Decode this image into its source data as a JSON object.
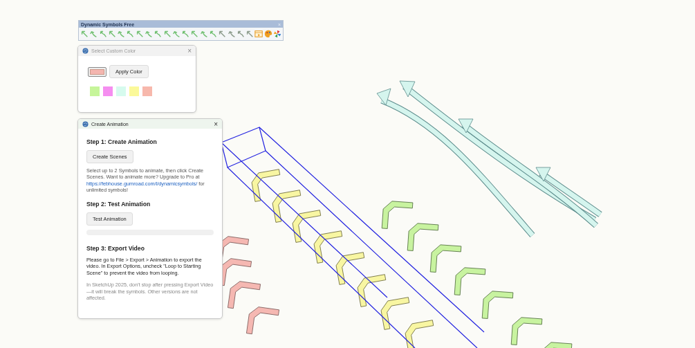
{
  "toolbar": {
    "title": "Dynamic Symbols Free",
    "close": "×"
  },
  "color_dialog": {
    "title": "Select Custom Color",
    "close": "×",
    "current_color": {
      "color": "#f4b6b0"
    },
    "apply_button": "Apply Color",
    "swatches": [
      {
        "color": "#c6f59a"
      },
      {
        "color": "#f58ef0"
      },
      {
        "color": "#d6fbee"
      },
      {
        "color": "#fbf99a"
      },
      {
        "color": "#f7b8ac"
      }
    ]
  },
  "animation_dialog": {
    "title": "Create Animation",
    "close": "×",
    "step1": {
      "heading": "Step 1: Create Animation",
      "button": "Create Scenes",
      "text_before": "Select up to 2 Symbols to animate, then click Create Scenes. Want to animate more? Upgrade to Pro at ",
      "link": "https://febhouse.gumroad.com/l/dynamicsymbols/",
      "text_after": " for unlimited symbols!"
    },
    "step2": {
      "heading": "Step 2: Test Animation",
      "button": "Test Animation",
      "progress": {
        "level": 0
      }
    },
    "step3": {
      "heading": "Step 3: Export Video",
      "instructions": "Please go to File > Export > Animation to export the video. In Export Options, uncheck \"Loop to Starting Scene\" to prevent the video from looping.",
      "note": "In SketchUp 2025, don't stop after pressing Export Video—it will break the symbols. Other versions are not affected."
    }
  }
}
